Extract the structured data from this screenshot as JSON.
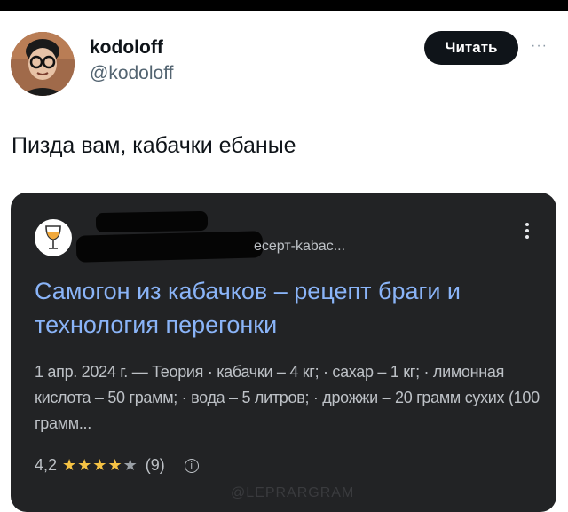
{
  "tweet": {
    "author_name": "kodoloff",
    "author_handle": "@kodoloff",
    "follow_label": "Читать",
    "more_label": "···",
    "text": "Пизда вам, кабачки ебаные"
  },
  "card": {
    "url_fragment": "есерт-kabac...",
    "title": "Самогон из кабачков – рецепт браги и технология перегонки",
    "snippet": "1 апр. 2024 г. — Теория · кабачки – 4 кг; · сахар – 1 кг; · лимонная кислота – 50 грамм; · вода – 5 литров; · дрожжи – 20 грамм сухих (100 грамм...",
    "rating_value": "4,2",
    "rating_stars": 4.2,
    "rating_count": "(9)",
    "info_icon": "info-icon"
  },
  "watermark": "@LEPRARGRAM",
  "colors": {
    "card_bg": "#222325",
    "link": "#8ab4f8",
    "star": "#f6c344",
    "button_bg": "#0f1419"
  }
}
